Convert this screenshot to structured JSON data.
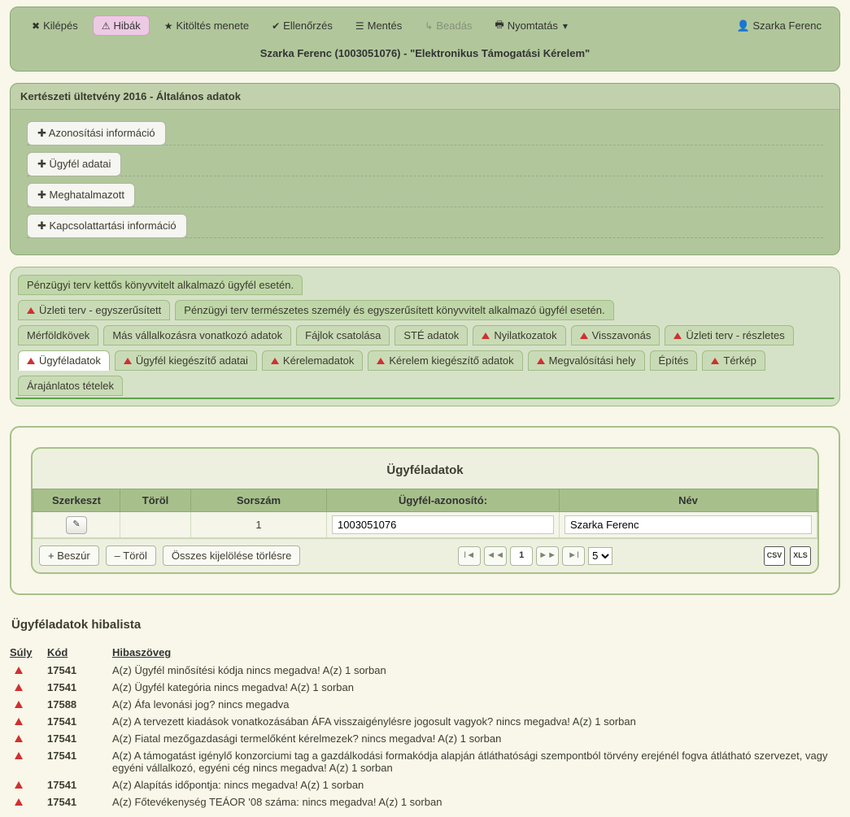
{
  "toolbar": {
    "kilepes": "Kilépés",
    "hibak": "Hibák",
    "kitoltes": "Kitöltés menete",
    "ellenorzes": "Ellenőrzés",
    "mentes": "Mentés",
    "beadas": "Beadás",
    "nyomtatas": "Nyomtatás",
    "user": "Szarka Ferenc"
  },
  "page_title": "Szarka Ferenc (1003051076) - \"Elektronikus Támogatási Kérelem\"",
  "section": {
    "header": "Kertészeti ültetvény 2016 - Általános adatok",
    "accordion": [
      "Azonosítási információ",
      "Ügyfél adatai",
      "Meghatalmazott",
      "Kapcsolattartási információ"
    ]
  },
  "tabs": {
    "row1": [
      {
        "label": "Pénzügyi terv kettős könyvvitelt alkalmazó ügyfél esetén.",
        "warn": false,
        "wide": true
      }
    ],
    "row2": [
      {
        "label": "Üzleti terv - egyszerűsített",
        "warn": true
      },
      {
        "label": "Pénzügyi terv természetes személy és egyszerűsített könyvvitelt alkalmazó ügyfél esetén.",
        "warn": false,
        "wide": true
      }
    ],
    "row3": [
      {
        "label": "Mérföldkövek",
        "warn": false
      },
      {
        "label": "Más vállalkozásra vonatkozó adatok",
        "warn": false
      },
      {
        "label": "Fájlok csatolása",
        "warn": false
      },
      {
        "label": "STÉ adatok",
        "warn": false
      },
      {
        "label": "Nyilatkozatok",
        "warn": true
      },
      {
        "label": "Visszavonás",
        "warn": true
      },
      {
        "label": "Üzleti terv - részletes",
        "warn": true
      }
    ],
    "row4": [
      {
        "label": "Ügyféladatok",
        "warn": true,
        "active": true
      },
      {
        "label": "Ügyfél kiegészítő adatai",
        "warn": true
      },
      {
        "label": "Kérelemadatok",
        "warn": true
      },
      {
        "label": "Kérelem kiegészítő adatok",
        "warn": true
      },
      {
        "label": "Megvalósítási hely",
        "warn": true
      },
      {
        "label": "Építés",
        "warn": false
      },
      {
        "label": "Térkép",
        "warn": true
      },
      {
        "label": "Árajánlatos tételek",
        "warn": false
      }
    ]
  },
  "grid": {
    "title": "Ügyféladatok",
    "headers": {
      "szerkeszt": "Szerkeszt",
      "torol": "Töröl",
      "sorszam": "Sorszám",
      "azon": "Ügyfél-azonosító:",
      "nev": "Név"
    },
    "row": {
      "sorszam": "1",
      "azon": "1003051076",
      "nev": "Szarka Ferenc"
    },
    "buttons": {
      "beszur": "+  Beszúr",
      "torol": "–  Töröl",
      "osszes": "Összes kijelölése törlésre"
    },
    "pager": {
      "page": "1",
      "size": "5"
    },
    "export": {
      "csv": "CSV",
      "xls": "XLS"
    }
  },
  "errlist": {
    "title": "Ügyféladatok hibalista",
    "headers": {
      "suly": "Súly",
      "kod": "Kód",
      "txt": "Hibaszöveg"
    },
    "rows": [
      {
        "kod": "17541",
        "txt": "A(z) Ügyfél minősítési kódja nincs megadva! A(z) 1 sorban"
      },
      {
        "kod": "17541",
        "txt": "A(z) Ügyfél kategória nincs megadva! A(z) 1 sorban"
      },
      {
        "kod": "17588",
        "txt": "A(z) Áfa levonási jog? nincs megadva"
      },
      {
        "kod": "17541",
        "txt": "A(z) A tervezett kiadások vonatkozásában ÁFA visszaigénylésre jogosult vagyok? nincs megadva! A(z) 1 sorban"
      },
      {
        "kod": "17541",
        "txt": "A(z) Fiatal mezőgazdasági termelőként kérelmezek? nincs megadva! A(z) 1 sorban"
      },
      {
        "kod": "17541",
        "txt": "A(z) A támogatást igénylő konzorciumi tag a gazdálkodási formakódja alapján átláthatósági szempontból törvény erejénél fogva átlátható szervezet, vagy egyéni vállalkozó, egyéni cég nincs megadva! A(z) 1 sorban"
      },
      {
        "kod": "17541",
        "txt": "A(z) Alapítás időpontja: nincs megadva! A(z) 1 sorban"
      },
      {
        "kod": "17541",
        "txt": "A(z) Főtevékenység TEÁOR '08 száma: nincs megadva! A(z) 1 sorban"
      }
    ]
  }
}
